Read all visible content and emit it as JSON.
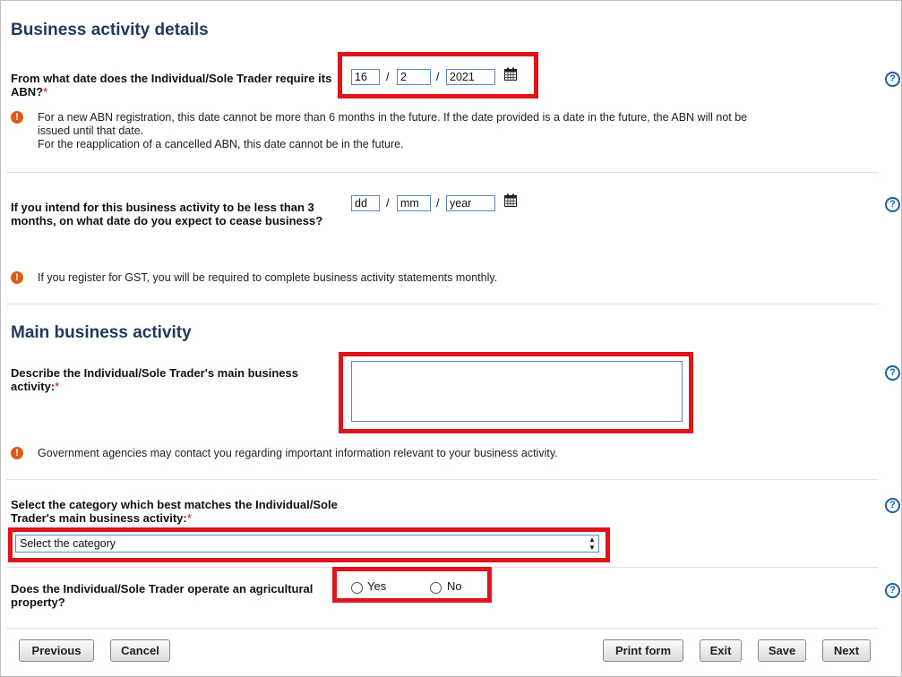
{
  "sections": {
    "business_activity_details": "Business activity details",
    "main_business_activity": "Main business activity"
  },
  "abn_date": {
    "label": "From what date does the Individual/Sole Trader require its ABN?",
    "required_mark": "*",
    "day": "16",
    "month": "2",
    "year": "2021",
    "info_lines": [
      "For a new ABN registration, this date cannot be more than 6 months in the future. If the date provided is a date in the future, the ABN will not be",
      "issued until that date.",
      "For the reapplication of a cancelled ABN, this date cannot be in the future."
    ]
  },
  "cease_date": {
    "label": "If you intend for this business activity to be less than 3 months, on what date do you expect to cease business?",
    "day_placeholder": "dd",
    "month_placeholder": "mm",
    "year_placeholder": "year",
    "gst_info": "If you register for GST, you will be required to complete business activity statements monthly."
  },
  "describe_activity": {
    "label": "Describe the Individual/Sole Trader's main business activity:",
    "required_mark": "*",
    "value": "",
    "info": "Government agencies may contact you regarding important information relevant to your business activity."
  },
  "category": {
    "label": "Select the category which best matches the Individual/Sole Trader's main business activity:",
    "required_mark": "*",
    "selected": "Select the category"
  },
  "agricultural": {
    "label": "Does the Individual/Sole Trader operate an agricultural property?",
    "yes_label": "Yes",
    "no_label": "No"
  },
  "buttons": {
    "previous": "Previous",
    "cancel": "Cancel",
    "print_form": "Print form",
    "exit": "Exit",
    "save": "Save",
    "next": "Next"
  },
  "glyphs": {
    "help": "?",
    "warning": "!",
    "select_arrows": "▲▼"
  },
  "icons": [
    "calendar-icon",
    "help-icon",
    "warning-icon"
  ],
  "colors": {
    "highlight": "#e0141b",
    "heading": "#1f3a5c",
    "help": "#1a5fa8",
    "warning": "#e25a0f",
    "required": "#cc0000"
  }
}
